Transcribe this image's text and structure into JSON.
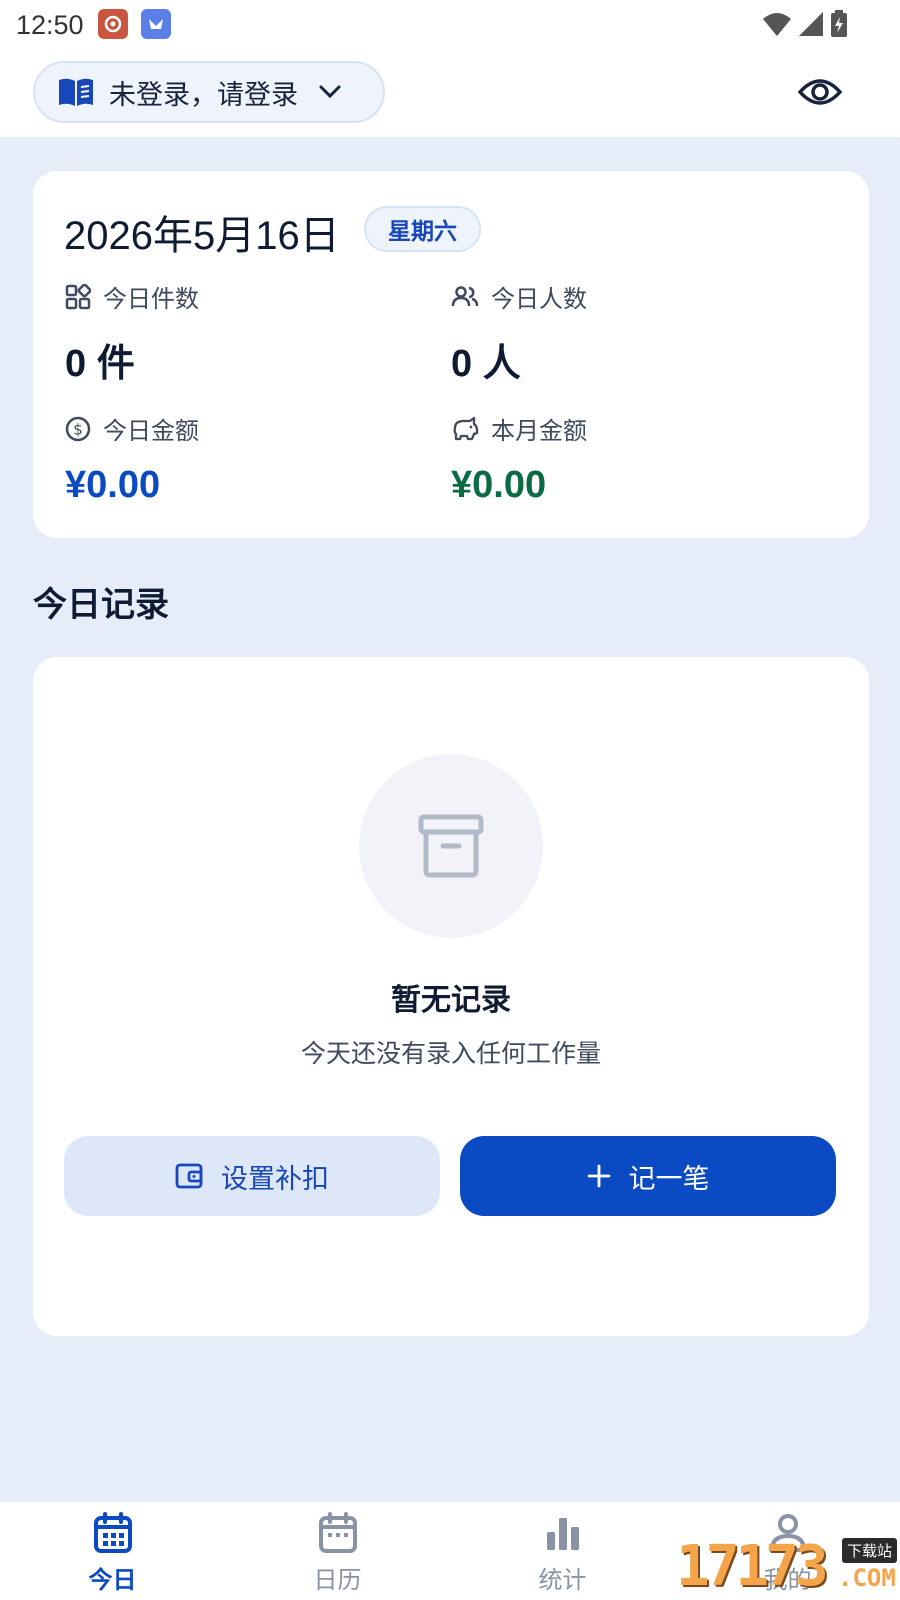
{
  "status_bar": {
    "time": "12:50"
  },
  "header": {
    "login_label": "未登录，请登录"
  },
  "summary": {
    "date": "2026年5月16日",
    "weekday": "星期六",
    "stats": [
      {
        "label": "今日件数",
        "value": "0 件"
      },
      {
        "label": "今日人数",
        "value": "0 人"
      },
      {
        "label": "今日金额",
        "value": "¥0.00"
      },
      {
        "label": "本月金额",
        "value": "¥0.00"
      }
    ]
  },
  "records": {
    "section_title": "今日记录",
    "empty_title": "暂无记录",
    "empty_subtitle": "今天还没有录入任何工作量",
    "secondary_button": "设置补扣",
    "primary_button": "记一笔"
  },
  "nav": {
    "items": [
      {
        "label": "今日",
        "active": true
      },
      {
        "label": "日历",
        "active": false
      },
      {
        "label": "统计",
        "active": false
      },
      {
        "label": "我的",
        "active": false
      }
    ]
  },
  "watermark": {
    "number": "17173",
    "tag": "下载站",
    "suffix": ".COM"
  },
  "colors": {
    "primary": "#0a4bc4",
    "money_green": "#0b6b44",
    "background": "#e6ecf8"
  }
}
